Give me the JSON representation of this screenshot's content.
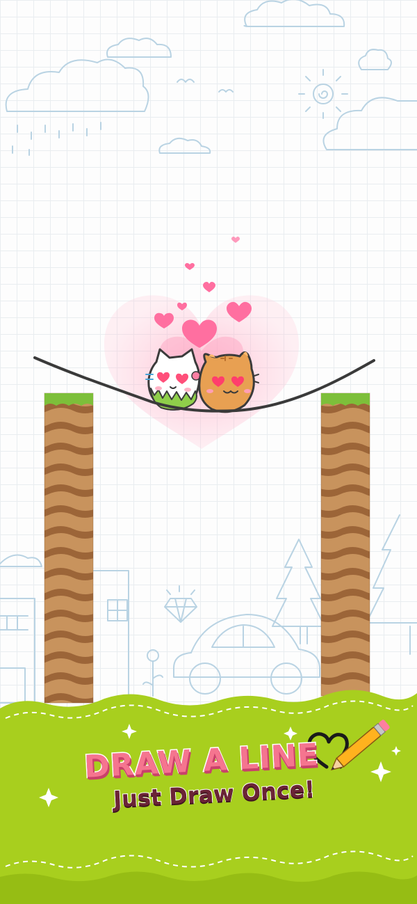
{
  "promo": {
    "headline": "DRAW A LINE",
    "subline": "Just Draw Once!"
  },
  "characters": {
    "left": "white-cat",
    "right": "orange-cat",
    "expression": "heart-eyes"
  },
  "colors": {
    "banner_green": "#a8cf1e",
    "headline_pink": "#f5758f",
    "subline_brown": "#6b2436",
    "heart_pink": "#ff6fa0",
    "grass_green": "#7dbf3a",
    "dirt_brown": "#b37a47",
    "orange_cat": "#e8a052"
  },
  "icons": [
    "heart-icon",
    "pencil-icon",
    "sparkle-icon",
    "diamond-icon",
    "sun-icon",
    "cloud-icon",
    "tree-icon",
    "car-icon",
    "house-icon"
  ]
}
